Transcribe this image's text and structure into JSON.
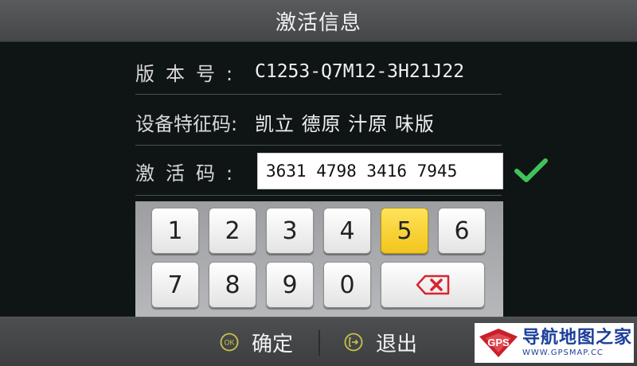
{
  "title": "激活信息",
  "info": {
    "version_label": "版本号:",
    "version_value": "C1253-Q7M12-3H21J22",
    "device_code_label": "设备特征码:",
    "device_code_value": "凯立 德原 汁原 味版",
    "activation_label": "激活码:",
    "activation_value": "3631 4798 3416 7945",
    "status_icon": "check-icon"
  },
  "keypad": {
    "keys": [
      "1",
      "2",
      "3",
      "4",
      "5",
      "6",
      "7",
      "8",
      "9",
      "0"
    ],
    "selected_key": "5",
    "backspace_icon": "backspace-icon"
  },
  "footer": {
    "confirm_icon_text": "OK",
    "confirm_label": "确定",
    "exit_label": "退出"
  },
  "watermark": {
    "logo_text": "GPS",
    "title": "导航地图之家",
    "url": "WWW.GPSMAP.CC"
  },
  "colors": {
    "accent_green": "#3fc35a",
    "key_highlight": "#f6d02c",
    "backspace_red": "#d9242e",
    "button_icon_yellow": "#c8c24a",
    "watermark_blue": "#1b3f9a",
    "watermark_red": "#c8202a"
  }
}
